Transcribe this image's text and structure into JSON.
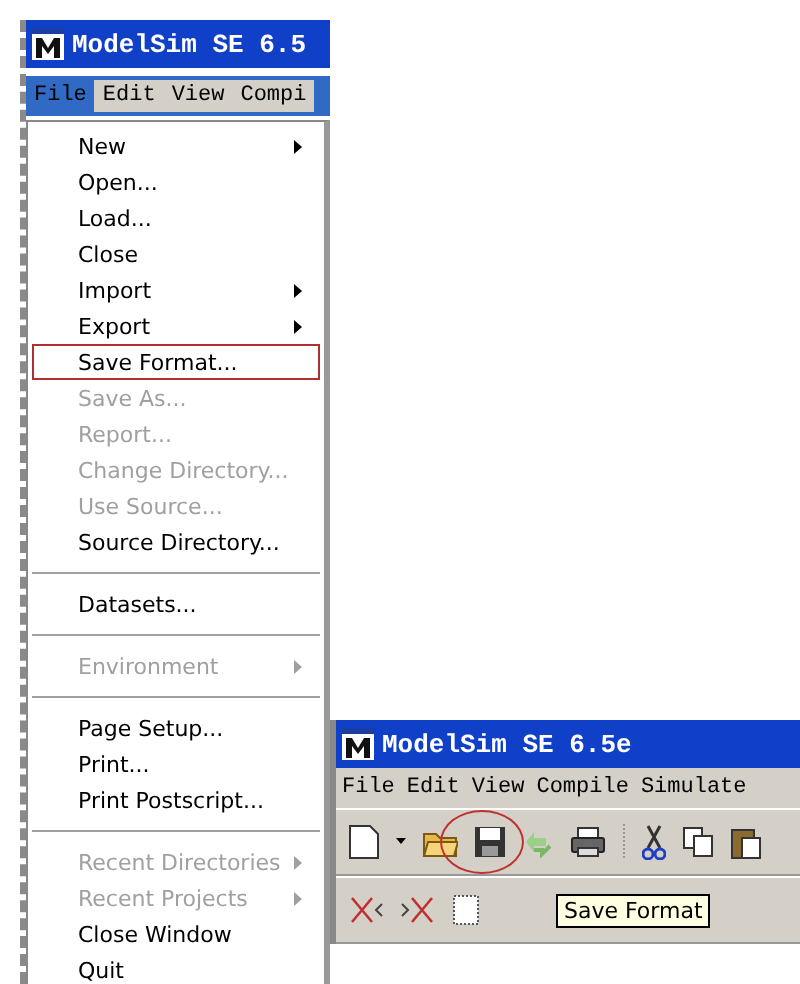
{
  "windows": [
    {
      "title": "ModelSim SE 6.5",
      "menubar": [
        {
          "label": "File",
          "selected": true
        },
        {
          "label": "Edit",
          "selected": false
        },
        {
          "label": "View",
          "selected": false
        },
        {
          "label": "Compi",
          "selected": false
        }
      ],
      "menu": [
        {
          "kind": "item",
          "label": "New",
          "disabled": false,
          "submenu": true,
          "highlighted": false
        },
        {
          "kind": "item",
          "label": "Open...",
          "disabled": false,
          "submenu": false,
          "highlighted": false
        },
        {
          "kind": "item",
          "label": "Load...",
          "disabled": false,
          "submenu": false,
          "highlighted": false
        },
        {
          "kind": "item",
          "label": "Close",
          "disabled": false,
          "submenu": false,
          "highlighted": false
        },
        {
          "kind": "item",
          "label": "Import",
          "disabled": false,
          "submenu": true,
          "highlighted": false
        },
        {
          "kind": "item",
          "label": "Export",
          "disabled": false,
          "submenu": true,
          "highlighted": false
        },
        {
          "kind": "item",
          "label": "Save Format...",
          "disabled": false,
          "submenu": false,
          "highlighted": true
        },
        {
          "kind": "item",
          "label": "Save As...",
          "disabled": true,
          "submenu": false,
          "highlighted": false
        },
        {
          "kind": "item",
          "label": "Report...",
          "disabled": true,
          "submenu": false,
          "highlighted": false
        },
        {
          "kind": "item",
          "label": "Change Directory...",
          "disabled": true,
          "submenu": false,
          "highlighted": false
        },
        {
          "kind": "item",
          "label": "Use Source...",
          "disabled": true,
          "submenu": false,
          "highlighted": false
        },
        {
          "kind": "item",
          "label": "Source Directory...",
          "disabled": false,
          "submenu": false,
          "highlighted": false
        },
        {
          "kind": "separator"
        },
        {
          "kind": "item",
          "label": "Datasets...",
          "disabled": false,
          "submenu": false,
          "highlighted": false
        },
        {
          "kind": "separator"
        },
        {
          "kind": "item",
          "label": "Environment",
          "disabled": true,
          "submenu": true,
          "highlighted": false
        },
        {
          "kind": "separator"
        },
        {
          "kind": "item",
          "label": "Page Setup...",
          "disabled": false,
          "submenu": false,
          "highlighted": false
        },
        {
          "kind": "item",
          "label": "Print...",
          "disabled": false,
          "submenu": false,
          "highlighted": false
        },
        {
          "kind": "item",
          "label": "Print Postscript...",
          "disabled": false,
          "submenu": false,
          "highlighted": false
        },
        {
          "kind": "separator"
        },
        {
          "kind": "item",
          "label": "Recent Directories",
          "disabled": true,
          "submenu": true,
          "highlighted": false
        },
        {
          "kind": "item",
          "label": "Recent Projects",
          "disabled": true,
          "submenu": true,
          "highlighted": false
        },
        {
          "kind": "item",
          "label": "Close Window",
          "disabled": false,
          "submenu": false,
          "highlighted": false
        },
        {
          "kind": "item",
          "label": "Quit",
          "disabled": false,
          "submenu": false,
          "highlighted": false
        }
      ]
    },
    {
      "title": "ModelSim SE 6.5e",
      "menubar": [
        {
          "label": "File",
          "selected": false
        },
        {
          "label": "Edit",
          "selected": false
        },
        {
          "label": "View",
          "selected": false
        },
        {
          "label": "Compile",
          "selected": false
        },
        {
          "label": "Simulate",
          "selected": false
        }
      ],
      "toolbar": [
        {
          "kind": "new"
        },
        {
          "kind": "caret"
        },
        {
          "kind": "open"
        },
        {
          "kind": "save",
          "highlighted": true
        },
        {
          "kind": "reload"
        },
        {
          "kind": "print"
        },
        {
          "kind": "sep"
        },
        {
          "kind": "cut"
        },
        {
          "kind": "copy"
        },
        {
          "kind": "paste"
        }
      ],
      "toolbar2": [
        {
          "kind": "xleft"
        },
        {
          "kind": "xright"
        },
        {
          "kind": "doc"
        }
      ],
      "tooltip": "Save Format"
    }
  ]
}
